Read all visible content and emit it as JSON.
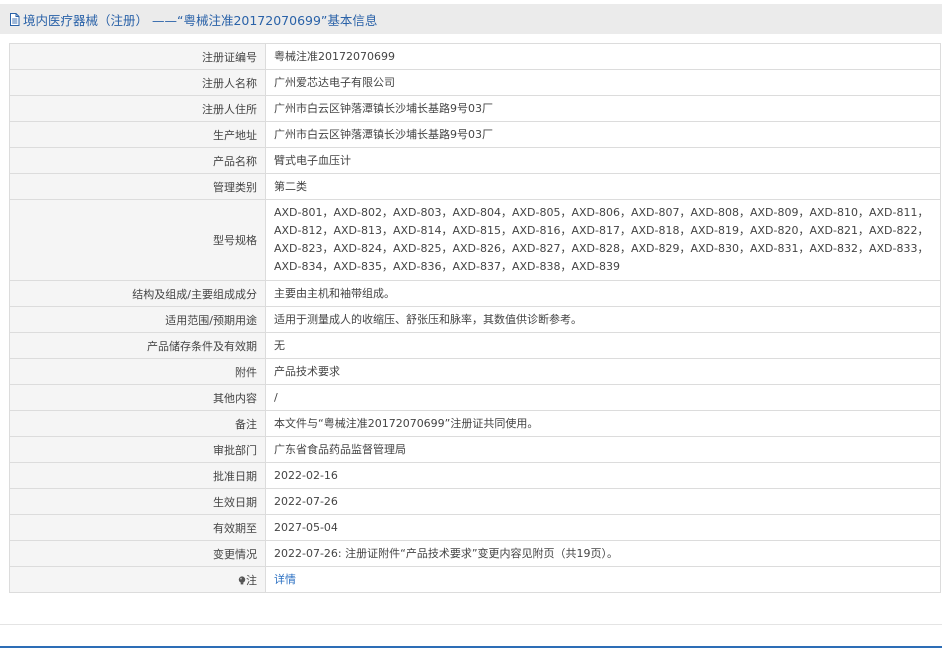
{
  "title": "境内医疗器械（注册） ——“粤械注准20172070699”基本信息",
  "rows": [
    {
      "label": "注册证编号",
      "value": "粤械注准20172070699"
    },
    {
      "label": "注册人名称",
      "value": "广州爱芯达电子有限公司"
    },
    {
      "label": "注册人住所",
      "value": "广州市白云区钟落潭镇长沙埔长基路9号03厂"
    },
    {
      "label": "生产地址",
      "value": "广州市白云区钟落潭镇长沙埔长基路9号03厂"
    },
    {
      "label": "产品名称",
      "value": "臂式电子血压计"
    },
    {
      "label": "管理类别",
      "value": "第二类"
    },
    {
      "label": "型号规格",
      "value": "AXD-801，AXD-802，AXD-803，AXD-804，AXD-805，AXD-806，AXD-807，AXD-808，AXD-809，AXD-810，AXD-811，AXD-812，AXD-813，AXD-814，AXD-815，AXD-816，AXD-817，AXD-818，AXD-819，AXD-820，AXD-821，AXD-822，AXD-823，AXD-824，AXD-825，AXD-826，AXD-827，AXD-828，AXD-829，AXD-830，AXD-831，AXD-832，AXD-833，AXD-834，AXD-835，AXD-836，AXD-837，AXD-838，AXD-839"
    },
    {
      "label": "结构及组成/主要组成成分",
      "value": "主要由主机和袖带组成。"
    },
    {
      "label": "适用范围/预期用途",
      "value": "适用于测量成人的收缩压、舒张压和脉率，其数值供诊断参考。"
    },
    {
      "label": "产品储存条件及有效期",
      "value": "无"
    },
    {
      "label": "附件",
      "value": "产品技术要求"
    },
    {
      "label": "其他内容",
      "value": "/"
    },
    {
      "label": "备注",
      "value": "本文件与“粤械注准20172070699”注册证共同使用。"
    },
    {
      "label": "审批部门",
      "value": "广东省食品药品监督管理局"
    },
    {
      "label": "批准日期",
      "value": "2022-02-16"
    },
    {
      "label": "生效日期",
      "value": "2022-07-26"
    },
    {
      "label": "有效期至",
      "value": "2027-05-04"
    },
    {
      "label": "变更情况",
      "value": "2022-07-26: 注册证附件“产品技术要求”变更内容见附页（共19页）。"
    }
  ],
  "note": {
    "label": "注",
    "link_text": "详情",
    "icon": "info-bulb-icon"
  },
  "icons": {
    "title": "document-icon"
  },
  "colors": {
    "title_text": "#2a62a8",
    "link": "#2a6fc2",
    "accent_rule": "#2d6db6"
  }
}
